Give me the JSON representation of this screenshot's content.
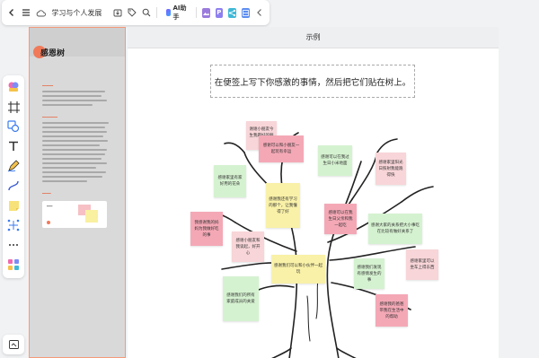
{
  "topbar": {
    "title": "学习与个人发展",
    "ai_label": "AI助手",
    "sq_p": "P"
  },
  "doc": {
    "title": "感恩树"
  },
  "frame": {
    "header": "示例",
    "instruction": "在便签上写下你感激的事情，然后把它们贴在树上。"
  },
  "notes": {
    "n1": "谢谢小朋友今生我最好的朋友",
    "n2": "感谢可以和小朋友一起玩有幸运",
    "n3": "感谢可以在我过生日小米地面",
    "n4": "感谢家里阳光日照射我能跑得快",
    "n5": "感谢家里有家好用的花朵",
    "n6": "感谢我还有学习的那个，让我懂得了好",
    "n7": "感谢可以在我生日父亲和我一起吃",
    "n8": "感谢大家的关系把大小事吃在比较有做好关系了",
    "n9": "我感谢我的妈妈为我做好吃的事",
    "n10": "感谢小朋友和我谈起，好开心",
    "n11": "感谢我们可以和小伙伴一起玩",
    "n12": "感谢家里可以坐车上得东西",
    "n13": "感谢我们发现有感情发生的事",
    "n14": "感谢我们的妈妈做手术提出帮助",
    "n15": "感谢我们的所有家庭成员的关爱",
    "n16": "感谢我的爸爸带我在生活中的帮助"
  },
  "colors": {
    "pink": "#f8d5d8",
    "rose": "#f4a8b6",
    "green": "#d5f2d0",
    "yellow": "#f9f1a8",
    "accent": "#f07a5a"
  }
}
